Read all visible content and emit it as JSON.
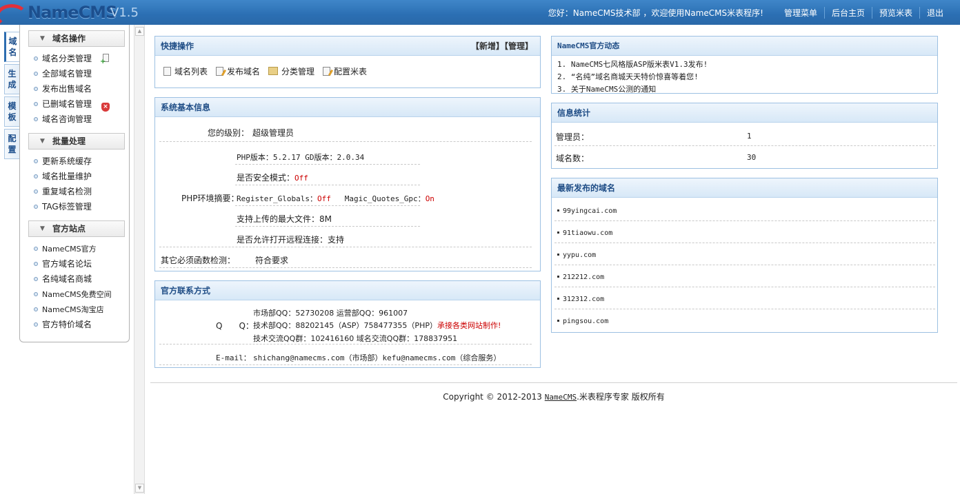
{
  "header": {
    "logo_text": "NameCMS",
    "logo_version": "V1.5",
    "welcome": "您好：NameCMS技术部 ，欢迎使用NameCMS米表程序!",
    "nav": [
      "管理菜单",
      "后台主页",
      "预览米表",
      "退出"
    ]
  },
  "vtabs": [
    "域名",
    "生成",
    "模板",
    "配置"
  ],
  "sidebar": {
    "groups": [
      {
        "title": "域名操作",
        "items": [
          "域名分类管理",
          "全部域名管理",
          "发布出售域名",
          "已删域名管理",
          "域名咨询管理"
        ]
      },
      {
        "title": "批量处理",
        "items": [
          "更新系统缓存",
          "域名批量维护",
          "重复域名检测",
          "TAG标签管理"
        ]
      },
      {
        "title": "官方站点",
        "items": [
          "NameCMS官方",
          "官方域名论坛",
          "名纯域名商城",
          "NameCMS免费空间",
          "NameCMS淘宝店",
          "官方特价域名"
        ]
      }
    ]
  },
  "quick": {
    "title": "快捷操作",
    "links": "【新增】【管理】",
    "items": [
      "域名列表",
      "发布域名",
      "分类管理",
      "配置米表"
    ]
  },
  "sysinfo": {
    "title": "系统基本信息",
    "level_label": "您的级别：",
    "level_value": "超级管理员",
    "php_label": "PHP环境摘要：",
    "php_version": "PHP版本：5.2.17 GD版本：2.0.34",
    "safe_mode_label": "是否安全模式：",
    "safe_mode_value": "Off",
    "register_globals_label": "Register_Globals：",
    "register_globals_value": "Off",
    "magic_quotes_label": "Magic_Quotes_Gpc：",
    "magic_quotes_value": "On",
    "upload_max": "支持上传的最大文件：8M",
    "remote_open": "是否允许打开远程连接：支持",
    "functions_label": "其它必须函数检测：",
    "functions_value": "符合要求"
  },
  "contact": {
    "title": "官方联系方式",
    "qq_label": "Q　　Q：",
    "qq_line1": "市场部QQ：52730208 运营部QQ：961007",
    "qq_line2": "技术部QQ：88202145（ASP）758477355（PHP）",
    "qq_line2_red": "承接各类网站制作!",
    "qq_line3": "技术交流QQ群：102416160 域名交流QQ群：178837951",
    "email_label": "E-mail：",
    "email_value": "shichang@namecms.com（市场部）kefu@namecms.com（综合服务）"
  },
  "news": {
    "title": "NameCMS官方动态",
    "items": [
      "1.  NameCMS七风格版ASP版米表V1.3发布!",
      "2.  “名纯”域名商城天天特价惊喜等着您!",
      "3.  关于NameCMS公测的通知"
    ]
  },
  "stats": {
    "title": "信息统计",
    "rows": [
      {
        "label": "管理员：",
        "value": "1"
      },
      {
        "label": "域名数：",
        "value": "30"
      }
    ]
  },
  "latest": {
    "title": "最新发布的域名",
    "domains": [
      "99yingcai.com",
      "91tiaowu.com",
      "yypu.com",
      "212212.com",
      "312312.com",
      "pingsou.com"
    ]
  },
  "footer": {
    "prefix": "Copyright © 2012-2013 ",
    "brand": "NameCMS",
    "suffix": ".米表程序专家 版权所有"
  }
}
